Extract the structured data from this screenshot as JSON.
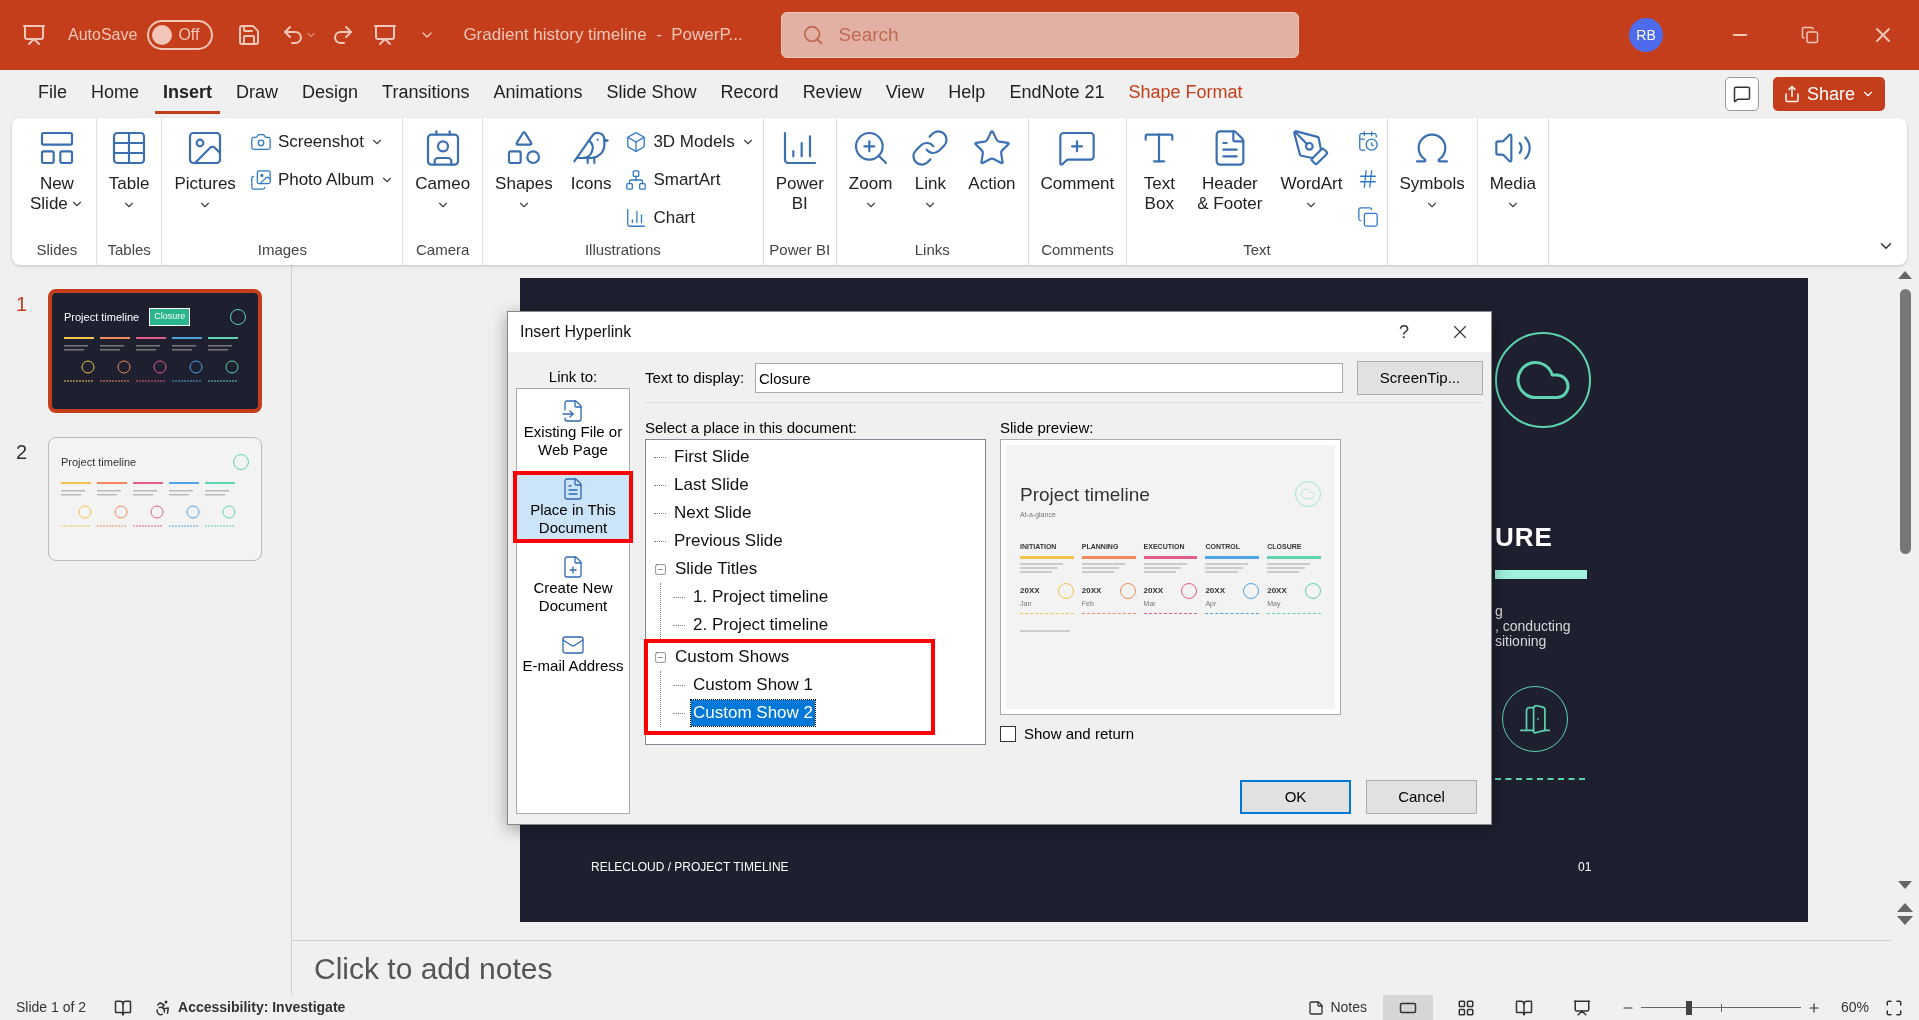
{
  "title_bar": {
    "autosave": {
      "label": "AutoSave",
      "on": false,
      "state_text": "Off"
    },
    "document_title": "Gradient history timeline  -  PowerP...",
    "search": {
      "placeholder": "Search"
    },
    "user": {
      "initials": "RB"
    }
  },
  "ribbon_tabs": [
    {
      "label": "File",
      "selected": false,
      "kind": "plain"
    },
    {
      "label": "Home",
      "selected": false,
      "kind": "plain"
    },
    {
      "label": "Insert",
      "selected": true,
      "kind": "plain"
    },
    {
      "label": "Draw",
      "selected": false,
      "kind": "plain"
    },
    {
      "label": "Design",
      "selected": false,
      "kind": "plain"
    },
    {
      "label": "Transitions",
      "selected": false,
      "kind": "plain"
    },
    {
      "label": "Animations",
      "selected": false,
      "kind": "plain"
    },
    {
      "label": "Slide Show",
      "selected": false,
      "kind": "plain"
    },
    {
      "label": "Record",
      "selected": false,
      "kind": "plain"
    },
    {
      "label": "Review",
      "selected": false,
      "kind": "plain"
    },
    {
      "label": "View",
      "selected": false,
      "kind": "plain"
    },
    {
      "label": "Help",
      "selected": false,
      "kind": "plain"
    },
    {
      "label": "EndNote 21",
      "selected": false,
      "kind": "plain"
    },
    {
      "label": "Shape Format",
      "selected": false,
      "kind": "contextual"
    }
  ],
  "share_button": "Share",
  "ribbon_groups": [
    {
      "label": "Slides",
      "items": [
        {
          "kind": "large",
          "lines": [
            "New",
            "Slide"
          ],
          "dropdown": true
        }
      ]
    },
    {
      "label": "Tables",
      "items": [
        {
          "kind": "large",
          "lines": [
            "Table"
          ],
          "dropdown": true
        }
      ]
    },
    {
      "label": "Images",
      "items": [
        {
          "kind": "large",
          "lines": [
            "Pictures"
          ],
          "dropdown": true
        },
        {
          "kind": "stack",
          "entries": [
            {
              "label": "Screenshot",
              "dropdown": true
            },
            {
              "label": "Photo Album",
              "dropdown": true
            }
          ]
        }
      ]
    },
    {
      "label": "Camera",
      "items": [
        {
          "kind": "large",
          "lines": [
            "Cameo"
          ],
          "dropdown": true
        }
      ]
    },
    {
      "label": "Illustrations",
      "items": [
        {
          "kind": "large",
          "lines": [
            "Shapes"
          ],
          "dropdown": true
        },
        {
          "kind": "large",
          "lines": [
            "Icons"
          ],
          "dropdown": false
        },
        {
          "kind": "stack",
          "entries": [
            {
              "label": "3D Models",
              "dropdown": true
            },
            {
              "label": "SmartArt",
              "dropdown": false
            },
            {
              "label": "Chart",
              "dropdown": false
            }
          ]
        }
      ]
    },
    {
      "label": "Power BI",
      "items": [
        {
          "kind": "large",
          "lines": [
            "Power",
            "BI"
          ],
          "dropdown": false
        }
      ]
    },
    {
      "label": "Links",
      "items": [
        {
          "kind": "large",
          "lines": [
            "Zoom"
          ],
          "dropdown": true
        },
        {
          "kind": "large",
          "lines": [
            "Link"
          ],
          "dropdown": true
        },
        {
          "kind": "large",
          "lines": [
            "Action"
          ],
          "dropdown": false
        }
      ]
    },
    {
      "label": "Comments",
      "items": [
        {
          "kind": "large",
          "lines": [
            "Comment"
          ],
          "dropdown": false
        }
      ]
    },
    {
      "label": "Text",
      "items": [
        {
          "kind": "large",
          "lines": [
            "Text",
            "Box"
          ],
          "dropdown": false
        },
        {
          "kind": "large",
          "lines": [
            "Header",
            "& Footer"
          ],
          "dropdown": false
        },
        {
          "kind": "large",
          "lines": [
            "WordArt"
          ],
          "dropdown": true
        },
        {
          "kind": "icons"
        }
      ]
    },
    {
      "items": [
        {
          "kind": "large",
          "lines": [
            "Symbols"
          ],
          "dropdown": true
        }
      ]
    },
    {
      "items": [
        {
          "kind": "large",
          "lines": [
            "Media"
          ],
          "dropdown": true
        }
      ]
    }
  ],
  "slides": [
    {
      "number": "1",
      "selected": true,
      "kind": "dark",
      "title": "Project timeline",
      "shape_label": "Closure"
    },
    {
      "number": "2",
      "selected": false,
      "kind": "light",
      "title": "Project timeline"
    }
  ],
  "slide": {
    "heading_fragment": "URE",
    "text_fragments": [
      "g",
      ", conducting",
      "sitioning"
    ],
    "footer": "RELECLOUD / PROJECT TIMELINE",
    "page_number": "01"
  },
  "notes": {
    "placeholder": "Click to add notes"
  },
  "dialog": {
    "title": "Insert Hyperlink",
    "help": "?",
    "link_to_label": "Link to:",
    "link_to": [
      {
        "label": "Existing File or Web Page",
        "selected": false,
        "highlighted": false
      },
      {
        "label": "Place in This Document",
        "selected": true,
        "highlighted": true
      },
      {
        "label": "Create New Document",
        "selected": false,
        "highlighted": false
      },
      {
        "label": "E-mail Address",
        "selected": false,
        "highlighted": false
      }
    ],
    "text_to_display": {
      "label": "Text to display:",
      "value": "Closure"
    },
    "screentip_button": "ScreenTip...",
    "place_label": "Select a place in this document:",
    "places": [
      {
        "label": "First Slide",
        "selected": false,
        "highlighted": false
      },
      {
        "label": "Last Slide",
        "selected": false,
        "highlighted": false
      },
      {
        "label": "Next Slide",
        "selected": false,
        "highlighted": false
      },
      {
        "label": "Previous Slide",
        "selected": false,
        "highlighted": false
      },
      {
        "label": "Slide Titles",
        "selected": false,
        "highlighted": false,
        "expanded": true,
        "children": [
          {
            "label": "1. Project timeline",
            "selected": false
          },
          {
            "label": "2. Project timeline",
            "selected": false
          }
        ]
      },
      {
        "label": "Custom Shows",
        "selected": false,
        "highlighted": true,
        "expanded": true,
        "children": [
          {
            "label": "Custom Show 1",
            "selected": false
          },
          {
            "label": "Custom Show 2",
            "selected": true
          }
        ]
      }
    ],
    "preview_label": "Slide preview:",
    "preview": {
      "title": "Project timeline",
      "subtitle": "At-a-glance",
      "phases": [
        {
          "name": "INITIATION",
          "year": "20XX",
          "month": "Jan",
          "color": "#f2c14e"
        },
        {
          "name": "PLANNING",
          "year": "20XX",
          "month": "Feb",
          "color": "#f08a5d"
        },
        {
          "name": "EXECUTION",
          "year": "20XX",
          "month": "Mar",
          "color": "#e35d8a"
        },
        {
          "name": "CONTROL",
          "year": "20XX",
          "month": "Apr",
          "color": "#4fa3e3"
        },
        {
          "name": "CLOSURE",
          "year": "20XX",
          "month": "May",
          "color": "#5fd3b0"
        }
      ]
    },
    "show_and_return": {
      "label": "Show and return",
      "checked": false
    },
    "buttons": [
      {
        "label": "OK",
        "kind": "default"
      },
      {
        "label": "Cancel",
        "kind": "normal"
      }
    ]
  },
  "status_bar": {
    "slide_count": "Slide 1 of 2",
    "accessibility": "Accessibility: Investigate",
    "notes_button": "Notes",
    "views": [
      {
        "selected": true
      },
      {
        "selected": false
      },
      {
        "selected": false
      },
      {
        "selected": false
      }
    ],
    "zoom": {
      "level": 0.3,
      "reading": "60%"
    }
  }
}
